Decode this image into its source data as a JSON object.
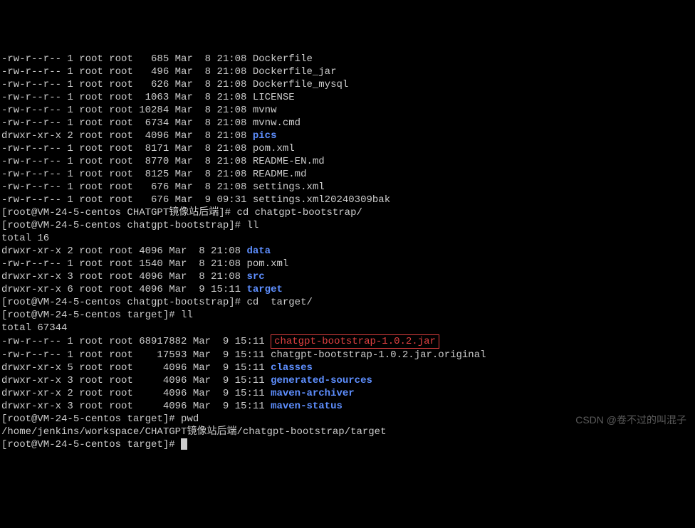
{
  "listing1": [
    {
      "perm": "-rw-r--r--",
      "n": "1",
      "u": "root",
      "g": "root",
      "size": "  685",
      "date": "Mar  8 21:08",
      "name": "Dockerfile",
      "dir": false
    },
    {
      "perm": "-rw-r--r--",
      "n": "1",
      "u": "root",
      "g": "root",
      "size": "  496",
      "date": "Mar  8 21:08",
      "name": "Dockerfile_jar",
      "dir": false
    },
    {
      "perm": "-rw-r--r--",
      "n": "1",
      "u": "root",
      "g": "root",
      "size": "  626",
      "date": "Mar  8 21:08",
      "name": "Dockerfile_mysql",
      "dir": false
    },
    {
      "perm": "-rw-r--r--",
      "n": "1",
      "u": "root",
      "g": "root",
      "size": " 1063",
      "date": "Mar  8 21:08",
      "name": "LICENSE",
      "dir": false
    },
    {
      "perm": "-rw-r--r--",
      "n": "1",
      "u": "root",
      "g": "root",
      "size": "10284",
      "date": "Mar  8 21:08",
      "name": "mvnw",
      "dir": false
    },
    {
      "perm": "-rw-r--r--",
      "n": "1",
      "u": "root",
      "g": "root",
      "size": " 6734",
      "date": "Mar  8 21:08",
      "name": "mvnw.cmd",
      "dir": false
    },
    {
      "perm": "drwxr-xr-x",
      "n": "2",
      "u": "root",
      "g": "root",
      "size": " 4096",
      "date": "Mar  8 21:08",
      "name": "pics",
      "dir": true
    },
    {
      "perm": "-rw-r--r--",
      "n": "1",
      "u": "root",
      "g": "root",
      "size": " 8171",
      "date": "Mar  8 21:08",
      "name": "pom.xml",
      "dir": false
    },
    {
      "perm": "-rw-r--r--",
      "n": "1",
      "u": "root",
      "g": "root",
      "size": " 8770",
      "date": "Mar  8 21:08",
      "name": "README-EN.md",
      "dir": false
    },
    {
      "perm": "-rw-r--r--",
      "n": "1",
      "u": "root",
      "g": "root",
      "size": " 8125",
      "date": "Mar  8 21:08",
      "name": "README.md",
      "dir": false
    },
    {
      "perm": "-rw-r--r--",
      "n": "1",
      "u": "root",
      "g": "root",
      "size": "  676",
      "date": "Mar  8 21:08",
      "name": "settings.xml",
      "dir": false
    },
    {
      "perm": "-rw-r--r--",
      "n": "1",
      "u": "root",
      "g": "root",
      "size": "  676",
      "date": "Mar  9 09:31",
      "name": "settings.xml20240309bak",
      "dir": false
    }
  ],
  "prompt1": {
    "text": "[root@VM-24-5-centos CHATGPT镜像站后端]# ",
    "cmd": "cd chatgpt-bootstrap/"
  },
  "prompt2": {
    "text": "[root@VM-24-5-centos chatgpt-bootstrap]# ",
    "cmd": "ll"
  },
  "total2": "total 16",
  "listing2": [
    {
      "perm": "drwxr-xr-x",
      "n": "2",
      "u": "root",
      "g": "root",
      "size": "4096",
      "date": "Mar  8 21:08",
      "name": "data",
      "dir": true
    },
    {
      "perm": "-rw-r--r--",
      "n": "1",
      "u": "root",
      "g": "root",
      "size": "1540",
      "date": "Mar  8 21:08",
      "name": "pom.xml",
      "dir": false
    },
    {
      "perm": "drwxr-xr-x",
      "n": "3",
      "u": "root",
      "g": "root",
      "size": "4096",
      "date": "Mar  8 21:08",
      "name": "src",
      "dir": true
    },
    {
      "perm": "drwxr-xr-x",
      "n": "6",
      "u": "root",
      "g": "root",
      "size": "4096",
      "date": "Mar  9 15:11",
      "name": "target",
      "dir": true
    }
  ],
  "prompt3": {
    "text": "[root@VM-24-5-centos chatgpt-bootstrap]# ",
    "cmd": "cd  target/"
  },
  "prompt4": {
    "text": "[root@VM-24-5-centos target]# ",
    "cmd": "ll"
  },
  "total3": "total 67344",
  "listing3": [
    {
      "perm": "-rw-r--r--",
      "n": "1",
      "u": "root",
      "g": "root",
      "size": "68917882",
      "date": "Mar  9 15:11",
      "name": "chatgpt-bootstrap-1.0.2.jar",
      "dir": false,
      "hl": true
    },
    {
      "perm": "-rw-r--r--",
      "n": "1",
      "u": "root",
      "g": "root",
      "size": "   17593",
      "date": "Mar  9 15:11",
      "name": "chatgpt-bootstrap-1.0.2.jar.original",
      "dir": false
    },
    {
      "perm": "drwxr-xr-x",
      "n": "5",
      "u": "root",
      "g": "root",
      "size": "    4096",
      "date": "Mar  9 15:11",
      "name": "classes",
      "dir": true
    },
    {
      "perm": "drwxr-xr-x",
      "n": "3",
      "u": "root",
      "g": "root",
      "size": "    4096",
      "date": "Mar  9 15:11",
      "name": "generated-sources",
      "dir": true
    },
    {
      "perm": "drwxr-xr-x",
      "n": "2",
      "u": "root",
      "g": "root",
      "size": "    4096",
      "date": "Mar  9 15:11",
      "name": "maven-archiver",
      "dir": true
    },
    {
      "perm": "drwxr-xr-x",
      "n": "3",
      "u": "root",
      "g": "root",
      "size": "    4096",
      "date": "Mar  9 15:11",
      "name": "maven-status",
      "dir": true
    }
  ],
  "prompt5": {
    "text": "[root@VM-24-5-centos target]# ",
    "cmd": "pwd"
  },
  "pwd_output": "/home/jenkins/workspace/CHATGPT镜像站后端/chatgpt-bootstrap/target",
  "prompt6": {
    "text": "[root@VM-24-5-centos target]# "
  },
  "watermark": "CSDN @卷不过的叫混子"
}
